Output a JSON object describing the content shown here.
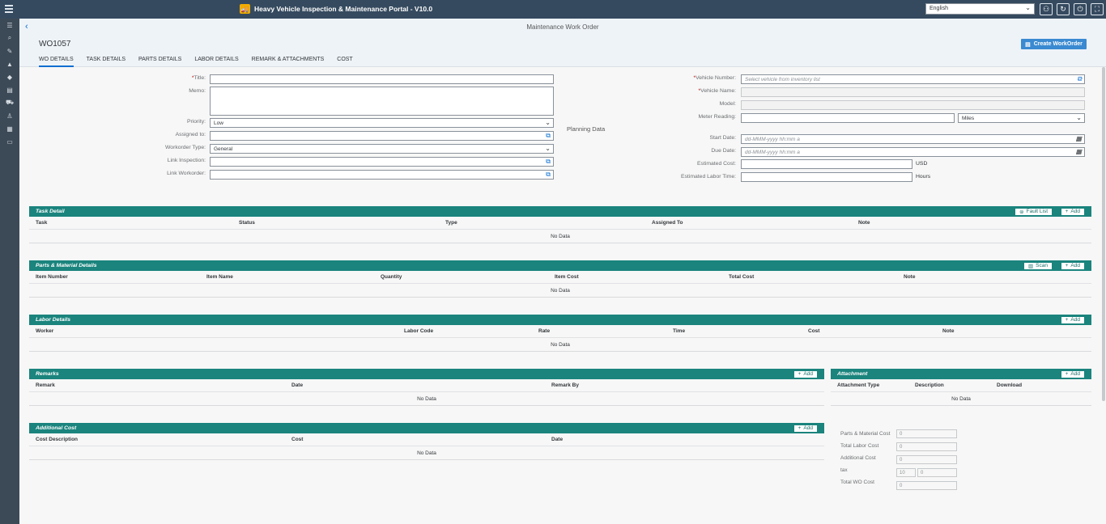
{
  "shell": {
    "title": "Heavy Vehicle Inspection & Maintenance Portal - V10.0",
    "language": "English"
  },
  "header": {
    "page_title": "Maintenance Work Order",
    "wo_number": "WO1057",
    "create_button": "Create WorkOrder",
    "tabs": [
      "WO DETAILS",
      "TASK DETAILS",
      "PARTS DETAILS",
      "LABOR DETAILS",
      "REMARK & ATTACHMENTS",
      "COST"
    ]
  },
  "form": {
    "title_label": "Title:",
    "memo_label": "Memo:",
    "priority_label": "Priority:",
    "priority_value": "Low",
    "assigned_label": "Assigned to:",
    "wotype_label": "Workorder Type:",
    "wotype_value": "General",
    "link_inspection_label": "Link Inspection:",
    "link_workorder_label": "Link Workorder:",
    "planning_label": "Planning Data",
    "vehicle_number_label": "Vehicle Number:",
    "vehicle_number_placeholder": "Select vehicle from inventory list",
    "vehicle_name_label": "Vehicle Name:",
    "model_label": "Model:",
    "meter_label": "Meter Reading:",
    "meter_unit": "Miles",
    "start_label": "Start Date:",
    "start_placeholder": "dd-MMM-yyyy hh:mm a",
    "due_label": "Due Date:",
    "due_placeholder": "dd-MMM-yyyy hh:mm a",
    "est_cost_label": "Estimated Cost:",
    "est_cost_unit": "USD",
    "est_labor_label": "Estimated Labor Time:",
    "est_labor_unit": "Hours",
    "required_mark": "*"
  },
  "tables": {
    "no_data": "No Data",
    "add": "Add",
    "task": {
      "title": "Task Detail",
      "fault_list": "Fault List",
      "columns": [
        "Task",
        "Status",
        "Type",
        "Assigned To",
        "Note"
      ]
    },
    "parts": {
      "title": "Parts & Material Details",
      "scan": "Scan",
      "columns": [
        "Item Number",
        "Item Name",
        "Quantity",
        "Item Cost",
        "Total Cost",
        "Note"
      ]
    },
    "labor": {
      "title": "Labor Details",
      "columns": [
        "Worker",
        "Labor Code",
        "Rate",
        "Time",
        "Cost",
        "Note"
      ]
    },
    "remarks": {
      "title": "Remarks",
      "columns": [
        "Remark",
        "Date",
        "Remark By"
      ]
    },
    "attachment": {
      "title": "Attachment",
      "columns": [
        "Attachment Type",
        "Description",
        "Download"
      ]
    },
    "additional": {
      "title": "Additional Cost",
      "columns": [
        "Cost Description",
        "Cost",
        "Date"
      ]
    }
  },
  "cost_summary": {
    "parts_label": "Parts & Material Cost",
    "parts_value": "0",
    "labor_label": "Total Labor Cost",
    "labor_value": "0",
    "additional_label": "Additional Cost",
    "additional_value": "0",
    "tax_label": "tax",
    "tax_rate": "10",
    "tax_value": "0",
    "total_label": "Total WO Cost",
    "total_value": "0"
  }
}
